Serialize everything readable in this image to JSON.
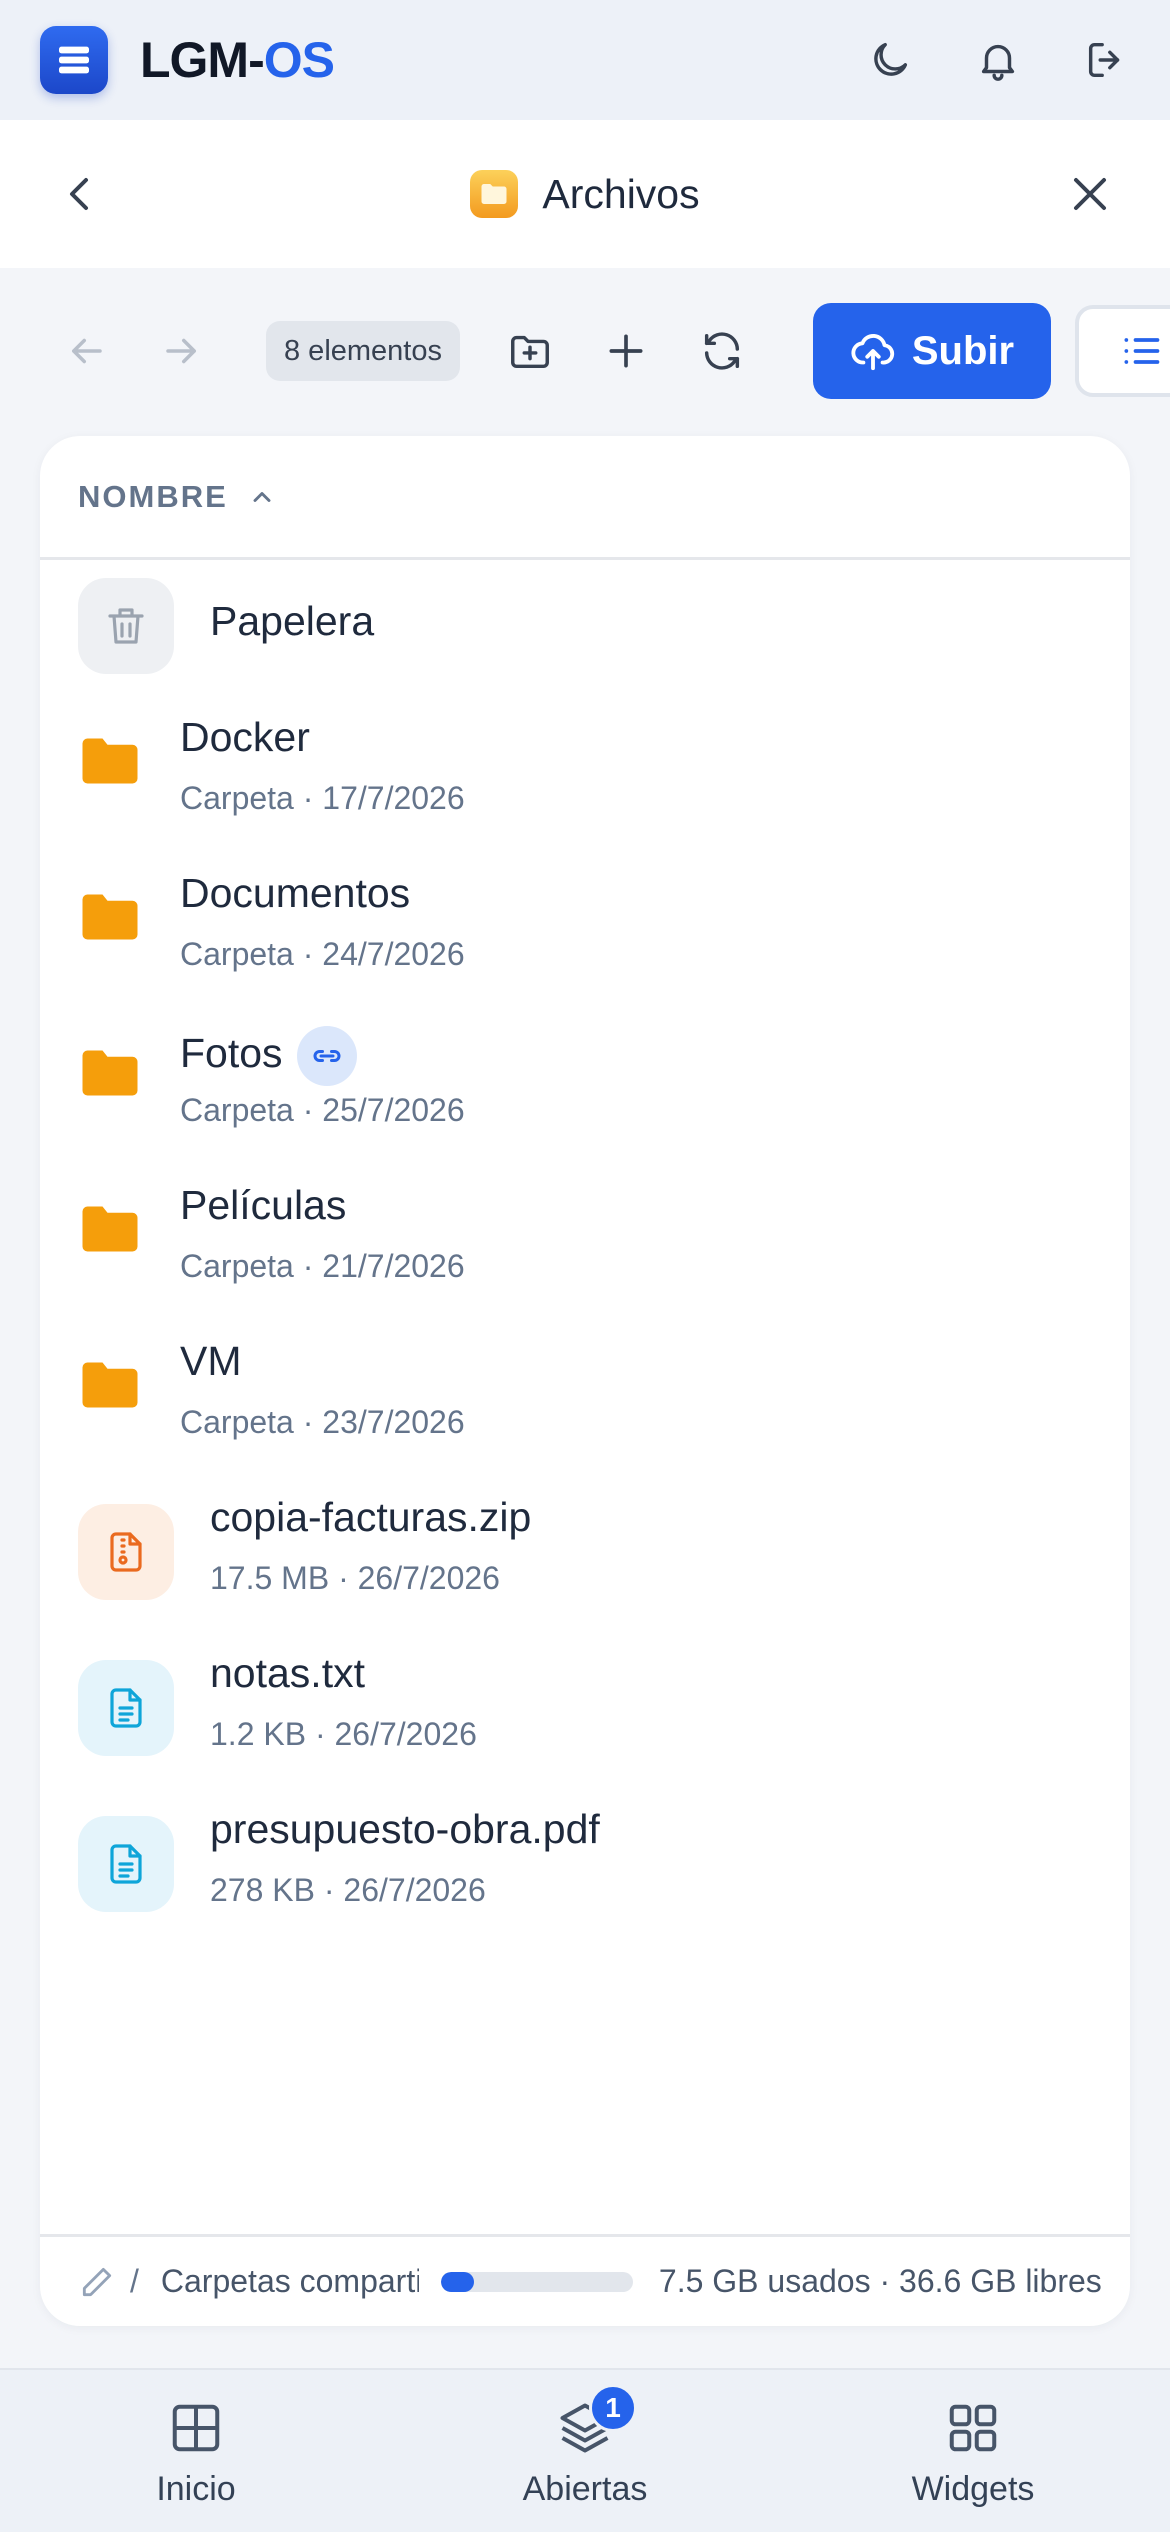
{
  "app": {
    "brand_main": "LGM-",
    "brand_accent": "OS",
    "accent_color": "#2563eb"
  },
  "topbar": {
    "icons": [
      "moon-icon",
      "bell-icon",
      "logout-icon"
    ]
  },
  "window": {
    "title": "Archivos",
    "icon": "folder-app-icon"
  },
  "toolbar": {
    "item_count": "8 elementos",
    "upload_label": "Subir"
  },
  "list": {
    "column_header": "NOMBRE",
    "sort": "ascending",
    "items": [
      {
        "name": "Papelera",
        "meta": "",
        "icon": "trash-icon"
      },
      {
        "name": "Docker",
        "meta": "Carpeta · 17/7/2026",
        "icon": "folder-icon"
      },
      {
        "name": "Documentos",
        "meta": "Carpeta · 24/7/2026",
        "icon": "folder-icon"
      },
      {
        "name": "Fotos",
        "meta": "Carpeta · 25/7/2026",
        "icon": "folder-icon",
        "shared": true
      },
      {
        "name": "Películas",
        "meta": "Carpeta · 21/7/2026",
        "icon": "folder-icon"
      },
      {
        "name": "VM",
        "meta": "Carpeta · 23/7/2026",
        "icon": "folder-icon"
      },
      {
        "name": "copia-facturas.zip",
        "meta": "17.5 MB · 26/7/2026",
        "icon": "zip-file-icon"
      },
      {
        "name": "notas.txt",
        "meta": "1.2 KB · 26/7/2026",
        "icon": "text-file-icon"
      },
      {
        "name": "presupuesto-obra.pdf",
        "meta": "278 KB · 26/7/2026",
        "icon": "text-file-icon"
      }
    ]
  },
  "footer": {
    "path_separator": "/",
    "folder": "Carpetas compartidas",
    "storage_used_fraction": 0.17,
    "storage_text": "7.5 GB usados · 36.6 GB libres"
  },
  "bottom_nav": {
    "items": [
      {
        "label": "Inicio",
        "icon": "grid-icon"
      },
      {
        "label": "Abiertas",
        "icon": "layers-icon",
        "badge": "1"
      },
      {
        "label": "Widgets",
        "icon": "widgets-icon"
      }
    ]
  }
}
